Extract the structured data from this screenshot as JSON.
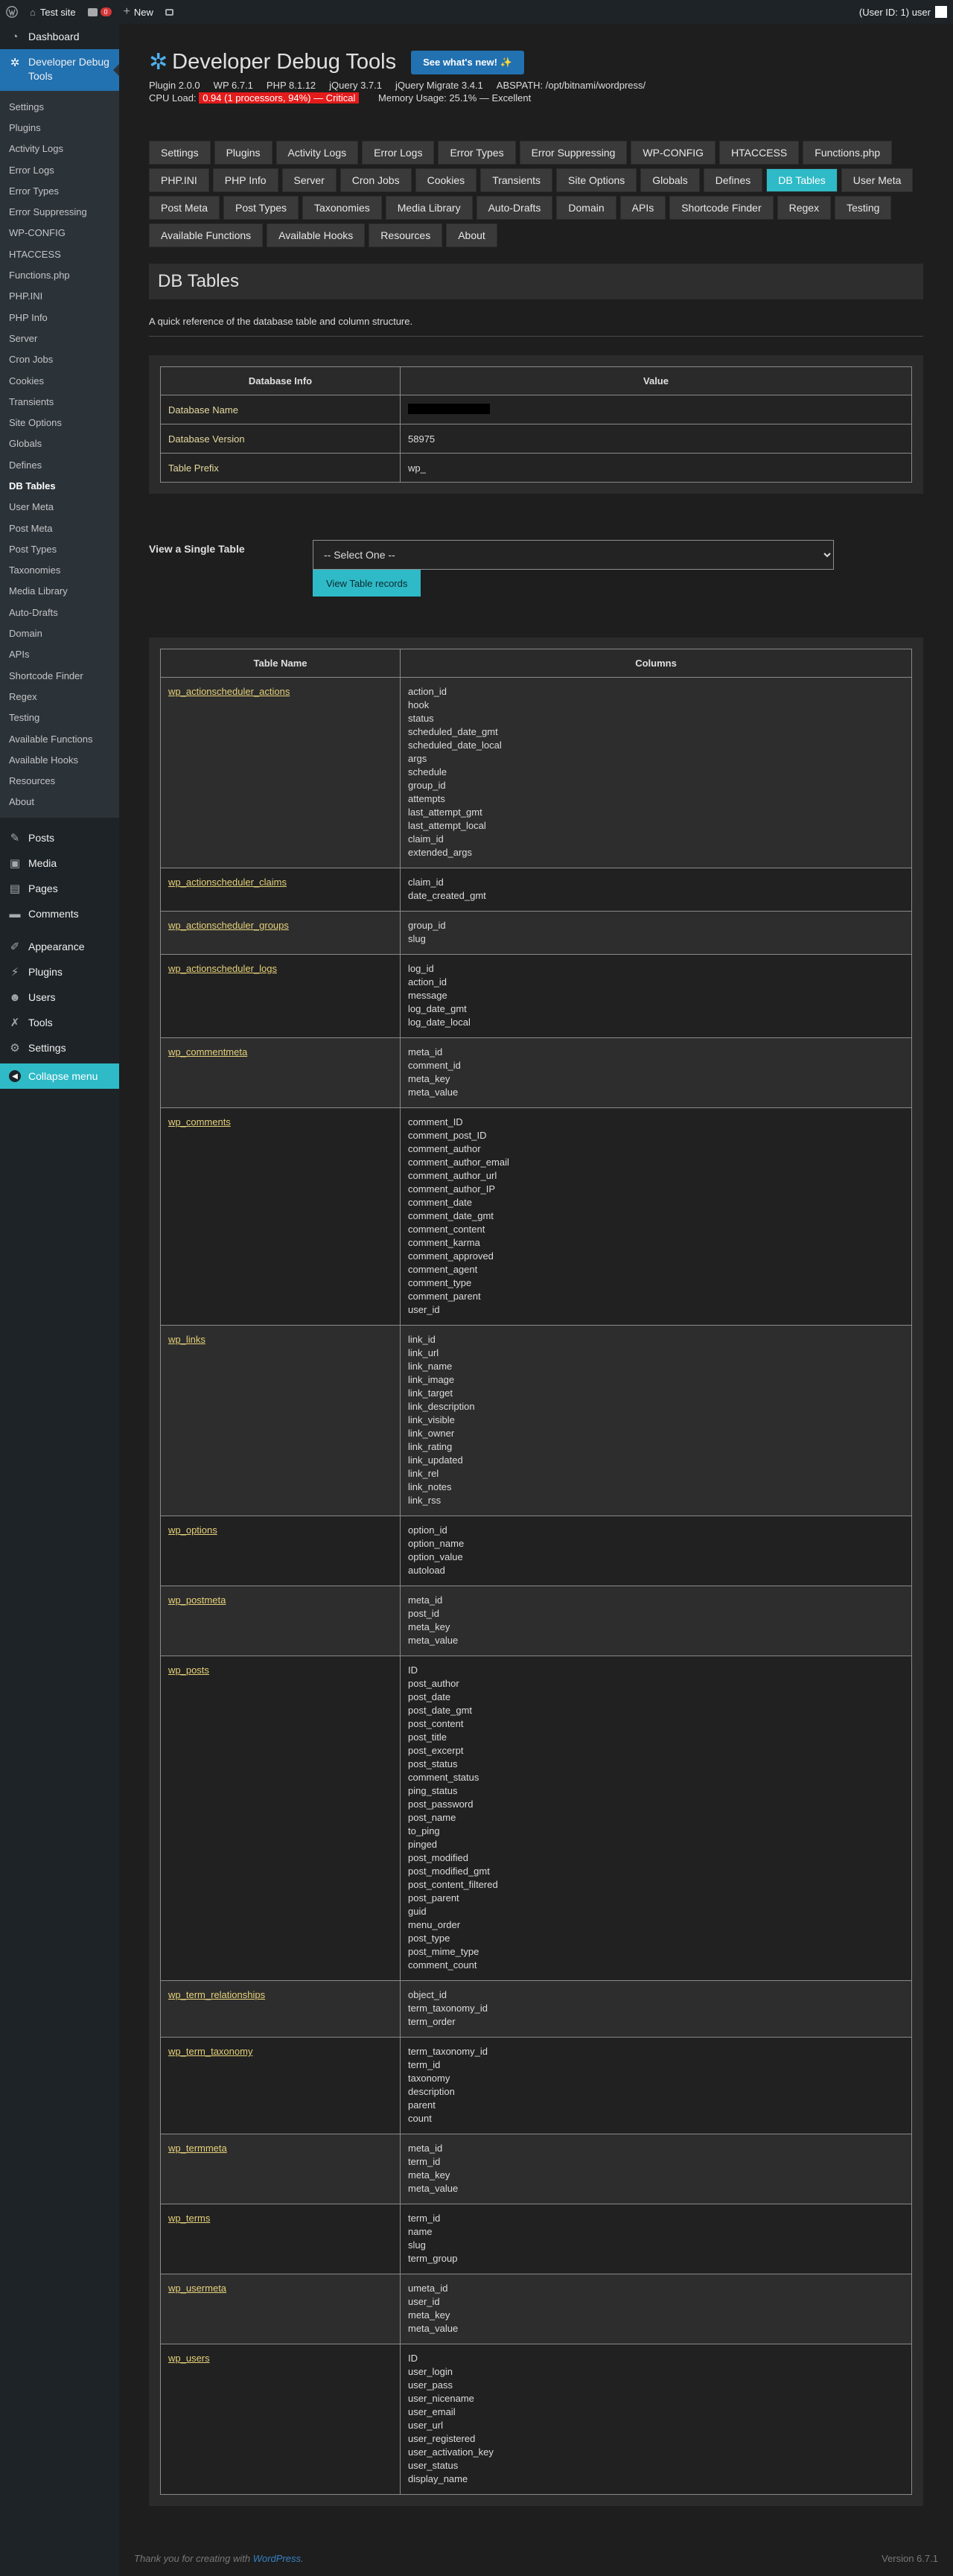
{
  "adminbar": {
    "site": "Test site",
    "comments_count": "0",
    "new_label": "New",
    "user": "(User ID: 1) user"
  },
  "sidebar": {
    "dashboard": "Dashboard",
    "active_plugin": "Developer Debug Tools",
    "subitems": [
      "Settings",
      "Plugins",
      "Activity Logs",
      "Error Logs",
      "Error Types",
      "Error Suppressing",
      "WP-CONFIG",
      "HTACCESS",
      "Functions.php",
      "PHP.INI",
      "PHP Info",
      "Server",
      "Cron Jobs",
      "Cookies",
      "Transients",
      "Site Options",
      "Globals",
      "Defines",
      "DB Tables",
      "User Meta",
      "Post Meta",
      "Post Types",
      "Taxonomies",
      "Media Library",
      "Auto-Drafts",
      "Domain",
      "APIs",
      "Shortcode Finder",
      "Regex",
      "Testing",
      "Available Functions",
      "Available Hooks",
      "Resources",
      "About"
    ],
    "current_sub": "DB Tables",
    "menu": [
      {
        "label": "Posts",
        "icon": "pin-icon"
      },
      {
        "label": "Media",
        "icon": "media-icon"
      },
      {
        "label": "Pages",
        "icon": "pages-icon"
      },
      {
        "label": "Comments",
        "icon": "comments-icon"
      },
      {
        "label": "Appearance",
        "icon": "brush-icon"
      },
      {
        "label": "Plugins",
        "icon": "plugin-icon"
      },
      {
        "label": "Users",
        "icon": "users-icon"
      },
      {
        "label": "Tools",
        "icon": "wrench-icon"
      },
      {
        "label": "Settings",
        "icon": "settings-icon"
      }
    ],
    "collapse": "Collapse menu"
  },
  "header": {
    "title": "Developer Debug Tools",
    "whats_new": "See what's new! ✨",
    "meta": [
      "Plugin 2.0.0",
      "WP 6.7.1",
      "PHP 8.1.12",
      "jQuery 3.7.1",
      "jQuery Migrate 3.4.1",
      "ABSPATH: /opt/bitnami/wordpress/"
    ],
    "cpu_label": "CPU Load:",
    "cpu_value": "0.94 (1 processors, 94%) — Critical",
    "memory": "Memory Usage: 25.1% — Excellent"
  },
  "tabs": [
    "Settings",
    "Plugins",
    "Activity Logs",
    "Error Logs",
    "Error Types",
    "Error Suppressing",
    "WP-CONFIG",
    "HTACCESS",
    "Functions.php",
    "PHP.INI",
    "PHP Info",
    "Server",
    "Cron Jobs",
    "Cookies",
    "Transients",
    "Site Options",
    "Globals",
    "Defines",
    "DB Tables",
    "User Meta",
    "Post Meta",
    "Post Types",
    "Taxonomies",
    "Media Library",
    "Auto-Drafts",
    "Domain",
    "APIs",
    "Shortcode Finder",
    "Regex",
    "Testing",
    "Available Functions",
    "Available Hooks",
    "Resources",
    "About"
  ],
  "active_tab": "DB Tables",
  "page": {
    "title": "DB Tables",
    "description": "A quick reference of the database table and column structure."
  },
  "dbinfo": {
    "headers": [
      "Database Info",
      "Value"
    ],
    "rows": [
      {
        "label": "Database Name",
        "value": ""
      },
      {
        "label": "Database Version",
        "value": "58975"
      },
      {
        "label": "Table Prefix",
        "value": "wp_"
      }
    ]
  },
  "single": {
    "label": "View a Single Table",
    "select_value": "-- Select One --",
    "button": "View Table records"
  },
  "tables_headers": [
    "Table Name",
    "Columns"
  ],
  "tables": [
    {
      "name": "wp_actionscheduler_actions",
      "columns": [
        "action_id",
        "hook",
        "status",
        "scheduled_date_gmt",
        "scheduled_date_local",
        "args",
        "schedule",
        "group_id",
        "attempts",
        "last_attempt_gmt",
        "last_attempt_local",
        "claim_id",
        "extended_args"
      ]
    },
    {
      "name": "wp_actionscheduler_claims",
      "columns": [
        "claim_id",
        "date_created_gmt"
      ]
    },
    {
      "name": "wp_actionscheduler_groups",
      "columns": [
        "group_id",
        "slug"
      ]
    },
    {
      "name": "wp_actionscheduler_logs",
      "columns": [
        "log_id",
        "action_id",
        "message",
        "log_date_gmt",
        "log_date_local"
      ]
    },
    {
      "name": "wp_commentmeta",
      "columns": [
        "meta_id",
        "comment_id",
        "meta_key",
        "meta_value"
      ]
    },
    {
      "name": "wp_comments",
      "columns": [
        "comment_ID",
        "comment_post_ID",
        "comment_author",
        "comment_author_email",
        "comment_author_url",
        "comment_author_IP",
        "comment_date",
        "comment_date_gmt",
        "comment_content",
        "comment_karma",
        "comment_approved",
        "comment_agent",
        "comment_type",
        "comment_parent",
        "user_id"
      ]
    },
    {
      "name": "wp_links",
      "columns": [
        "link_id",
        "link_url",
        "link_name",
        "link_image",
        "link_target",
        "link_description",
        "link_visible",
        "link_owner",
        "link_rating",
        "link_updated",
        "link_rel",
        "link_notes",
        "link_rss"
      ]
    },
    {
      "name": "wp_options",
      "columns": [
        "option_id",
        "option_name",
        "option_value",
        "autoload"
      ]
    },
    {
      "name": "wp_postmeta",
      "columns": [
        "meta_id",
        "post_id",
        "meta_key",
        "meta_value"
      ]
    },
    {
      "name": "wp_posts",
      "columns": [
        "ID",
        "post_author",
        "post_date",
        "post_date_gmt",
        "post_content",
        "post_title",
        "post_excerpt",
        "post_status",
        "comment_status",
        "ping_status",
        "post_password",
        "post_name",
        "to_ping",
        "pinged",
        "post_modified",
        "post_modified_gmt",
        "post_content_filtered",
        "post_parent",
        "guid",
        "menu_order",
        "post_type",
        "post_mime_type",
        "comment_count"
      ]
    },
    {
      "name": "wp_term_relationships",
      "columns": [
        "object_id",
        "term_taxonomy_id",
        "term_order"
      ]
    },
    {
      "name": "wp_term_taxonomy",
      "columns": [
        "term_taxonomy_id",
        "term_id",
        "taxonomy",
        "description",
        "parent",
        "count"
      ]
    },
    {
      "name": "wp_termmeta",
      "columns": [
        "meta_id",
        "term_id",
        "meta_key",
        "meta_value"
      ]
    },
    {
      "name": "wp_terms",
      "columns": [
        "term_id",
        "name",
        "slug",
        "term_group"
      ]
    },
    {
      "name": "wp_usermeta",
      "columns": [
        "umeta_id",
        "user_id",
        "meta_key",
        "meta_value"
      ]
    },
    {
      "name": "wp_users",
      "columns": [
        "ID",
        "user_login",
        "user_pass",
        "user_nicename",
        "user_email",
        "user_url",
        "user_registered",
        "user_activation_key",
        "user_status",
        "display_name"
      ]
    }
  ],
  "footer": {
    "thanks_prefix": "Thank you for creating with ",
    "thanks_link": "WordPress",
    "thanks_suffix": ".",
    "version": "Version 6.7.1"
  }
}
